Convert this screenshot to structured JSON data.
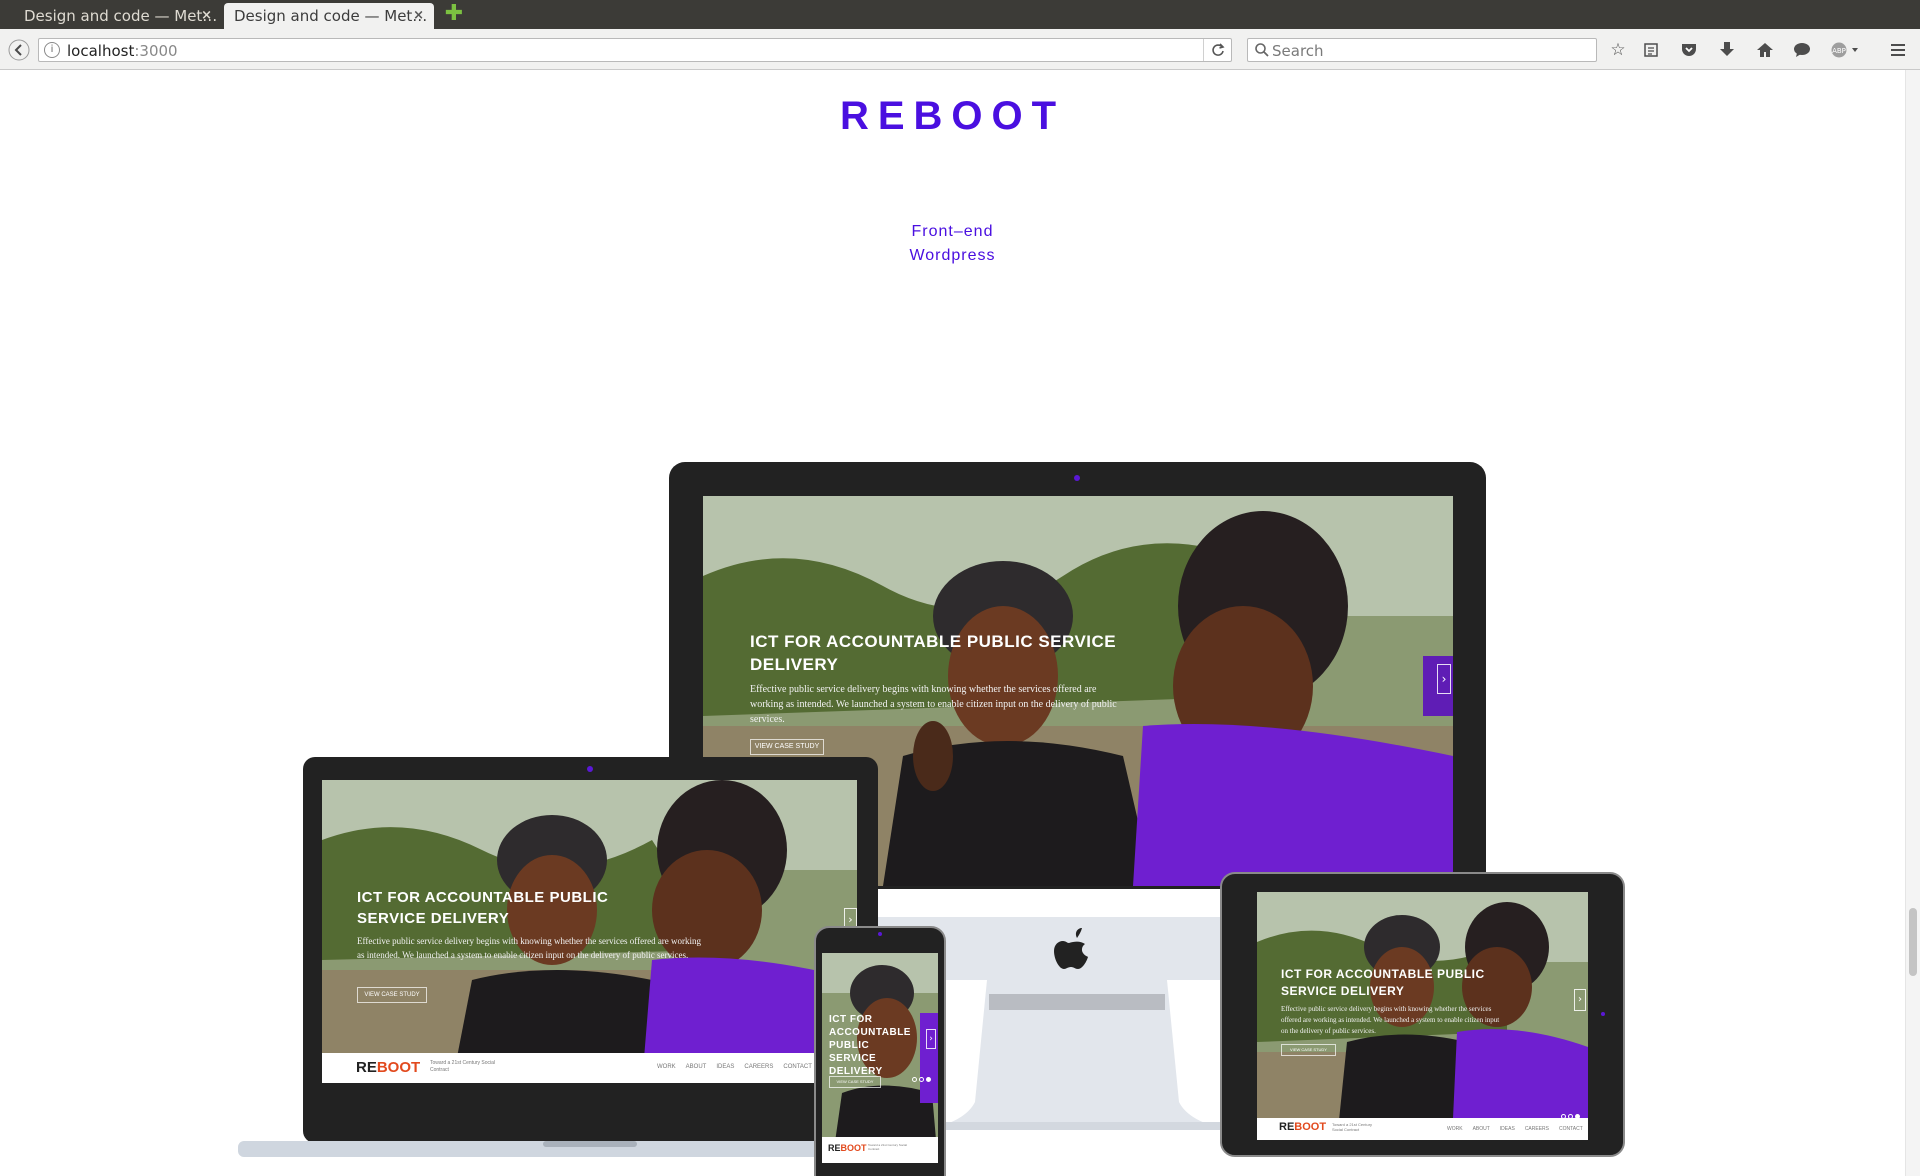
{
  "browser": {
    "tabs": [
      {
        "title": "Design and code — Met…",
        "close": "×"
      },
      {
        "title": "Design and code — Met…",
        "close": "×"
      }
    ],
    "new_tab": "✚",
    "url_host": "localhost",
    "url_port": ":3000",
    "search_placeholder": "Search",
    "icons": [
      "back-icon",
      "info-icon",
      "reload-icon",
      "search-icon",
      "bookmark-star-icon",
      "reading-list-icon",
      "pocket-icon",
      "download-icon",
      "home-icon",
      "chat-icon",
      "adblock-icon",
      "menu-icon"
    ]
  },
  "page": {
    "logo": "REBOOT",
    "tags": [
      "Front–end",
      "Wordpress"
    ],
    "accent_color": "#4a0fe0"
  },
  "showcase": {
    "headline": "ICT FOR ACCOUNTABLE PUBLIC SERVICE DELIVERY",
    "body": "Effective public service delivery begins with knowing whether the services offered are working as intended. We launched a system to enable citizen input on the delivery of public services.",
    "cta": "VIEW CASE STUDY",
    "footer_logo_re": "RE",
    "footer_logo_boot": "BOOT",
    "footer_tagline": "Toward a 21st Century Social Contract",
    "footer_nav": [
      "WORK",
      "ABOUT",
      "IDEAS",
      "CAREERS",
      "CONTACT"
    ],
    "brand_color": "#e24a1e"
  }
}
